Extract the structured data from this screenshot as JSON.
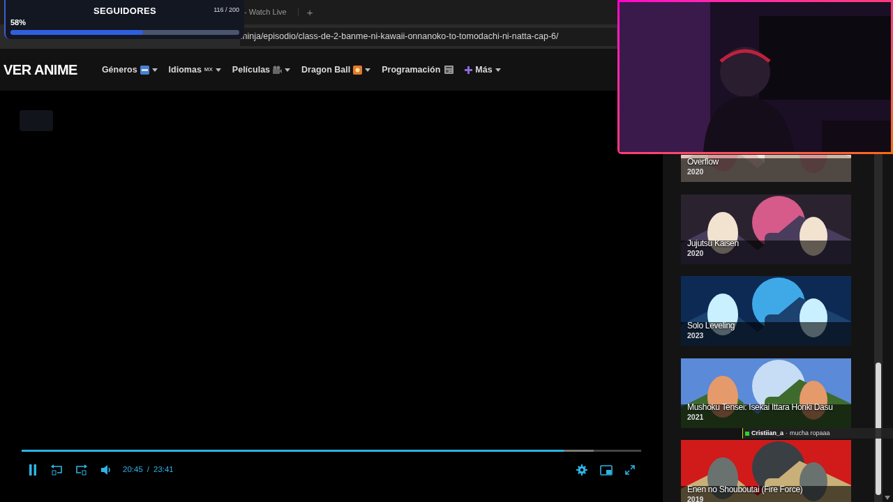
{
  "browser": {
    "tab_title": "- Watch Live",
    "new_tab": "+",
    "url": ".ninja/episodio/class-de-2-banme-ni-kawaii-onnanoko-to-tomodachi-ni-natta-cap-6/"
  },
  "followers_goal": {
    "title": "SEGUIDORES",
    "percent": "58%",
    "count": "116 / 200",
    "level": 0.58
  },
  "site": {
    "logo": "VER ANIME"
  },
  "nav": [
    {
      "label": "Géneros",
      "dropdown": true
    },
    {
      "label": "Idiomas",
      "badge": "MX",
      "dropdown": true
    },
    {
      "label": "Películas",
      "dropdown": true
    },
    {
      "label": "Dragon Ball",
      "dropdown": true
    },
    {
      "label": "Programación",
      "dropdown": false
    },
    {
      "label": "Más",
      "dropdown": true
    }
  ],
  "player": {
    "playing": true,
    "progress": {
      "level": 0.875
    },
    "buffer": {
      "level": 0.923
    },
    "current_time": "20:45",
    "separator": "/",
    "duration": "23:41"
  },
  "related": [
    {
      "title": "Overflow",
      "year": "2020"
    },
    {
      "title": "Jujutsu Kaisen",
      "year": "2020"
    },
    {
      "title": "Solo Leveling",
      "year": "2023"
    },
    {
      "title": "Mushoku Tensei: Isekai Ittara Honki Dasu",
      "year": "2021"
    },
    {
      "title": "Enen no Shouboutai (Fire Force)",
      "year": "2019"
    }
  ],
  "chat_overlay": {
    "user": "Cristiian_a",
    "separator": "·",
    "message": "mucha ropaaa"
  }
}
